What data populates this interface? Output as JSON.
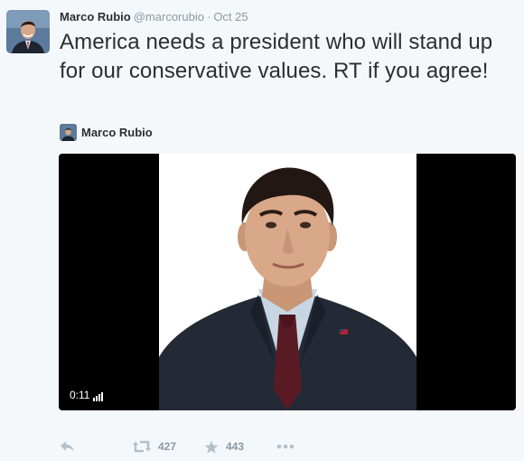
{
  "tweet": {
    "fullname": "Marco Rubio",
    "username": "@marcorubio",
    "separator": "·",
    "timestamp": "Oct 25",
    "text": "America needs a president who will stand up for our conservative values. RT if you agree!"
  },
  "card": {
    "author_name": "Marco Rubio"
  },
  "video": {
    "duration": "0:11"
  },
  "actions": {
    "reply_icon": "reply-icon",
    "retweet_icon": "retweet-icon",
    "retweet_count": "427",
    "favorite_icon": "star-icon",
    "favorite_count": "443",
    "more_icon": "more-icon"
  },
  "colors": {
    "background": "#f5f8fa",
    "text": "#292f33",
    "muted": "#8899a6"
  }
}
